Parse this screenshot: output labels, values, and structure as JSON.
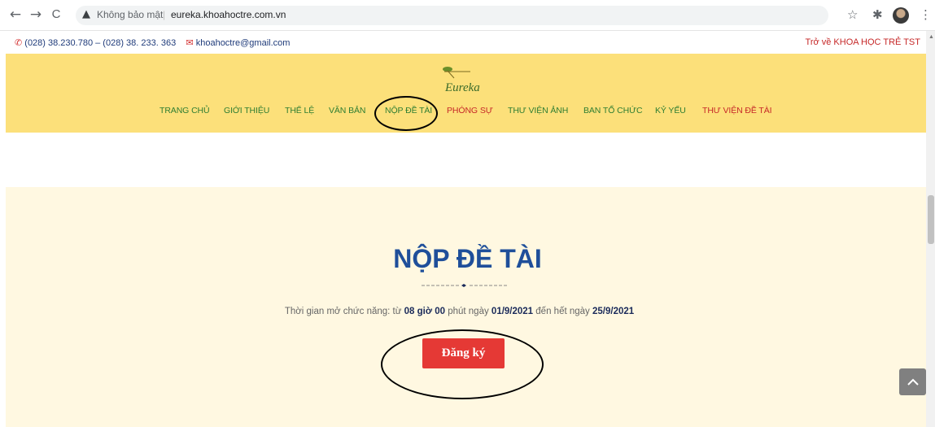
{
  "browser": {
    "back_icon": "←",
    "forward_icon": "→",
    "reload_icon": "C",
    "warning_icon": "▲",
    "not_secure": "Không bảo mật",
    "separator": "|",
    "url": "eureka.khoahoctre.com.vn",
    "star_icon": "☆",
    "extensions_icon": "✱",
    "menu_icon": "⋮"
  },
  "topbar": {
    "phone_icon": "✆",
    "phone": "(028) 38.230.780 – (028) 38. 233. 363",
    "mail_icon": "✉",
    "email": "khoahoctre@gmail.com",
    "back_link": "Trở về KHOA HỌC TRẺ TST"
  },
  "logo": {
    "text": "Eureka"
  },
  "menu": {
    "items": [
      {
        "label": "TRANG CHỦ"
      },
      {
        "label": "GIỚI THIỆU"
      },
      {
        "label": "THỂ LỆ"
      },
      {
        "label": "VĂN BẢN"
      },
      {
        "label": "NỘP ĐỀ TÀI"
      },
      {
        "label": "PHÓNG SỰ"
      },
      {
        "label": "THƯ VIỆN ẢNH"
      },
      {
        "label": "BAN TỔ CHỨC"
      },
      {
        "label": "KỶ YẾU"
      },
      {
        "label": "THƯ VIỆN ĐỀ TÀI"
      }
    ]
  },
  "main": {
    "title": "NỘP ĐỀ TÀI",
    "subtitle": {
      "prefix": "Thời gian mở chức năng: từ ",
      "time": "08 giờ 00",
      "mid1": " phút ngày ",
      "start_date": "01/9/2021",
      "mid2": " đến hết ngày ",
      "end_date": "25/9/2021"
    },
    "register_button": "Đăng ký"
  },
  "back_to_top_icon": "^",
  "colors": {
    "header_bg": "#fce07a",
    "menu_green": "#2e7d32",
    "menu_red": "#c62828",
    "title_blue": "#1f4f9a",
    "button_red": "#e53935",
    "section_bg": "#fff8e1"
  }
}
